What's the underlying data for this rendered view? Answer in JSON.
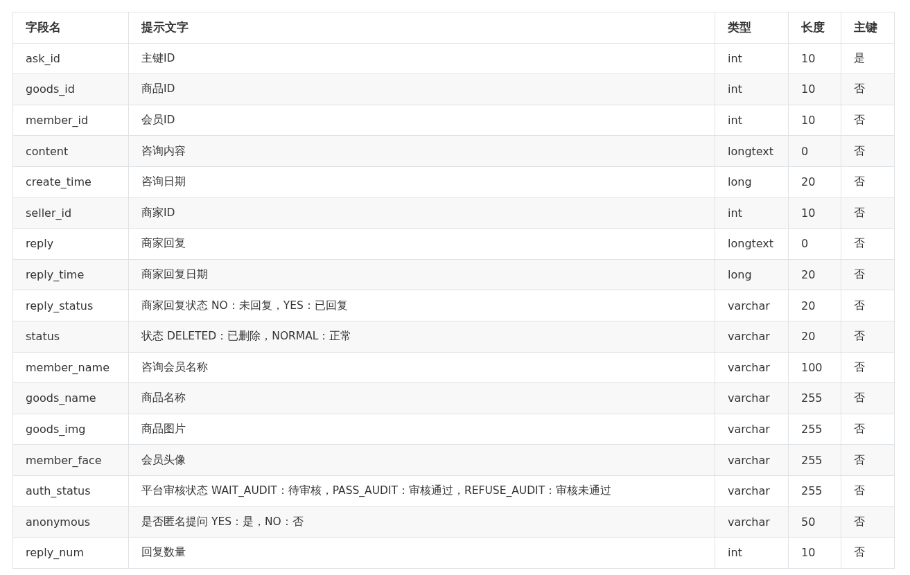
{
  "table": {
    "columns": [
      "字段名",
      "提示文字",
      "类型",
      "长度",
      "主键"
    ],
    "rows": [
      [
        "ask_id",
        "主键ID",
        "int",
        "10",
        "是"
      ],
      [
        "goods_id",
        "商品ID",
        "int",
        "10",
        "否"
      ],
      [
        "member_id",
        "会员ID",
        "int",
        "10",
        "否"
      ],
      [
        "content",
        "咨询内容",
        "longtext",
        "0",
        "否"
      ],
      [
        "create_time",
        "咨询日期",
        "long",
        "20",
        "否"
      ],
      [
        "seller_id",
        "商家ID",
        "int",
        "10",
        "否"
      ],
      [
        "reply",
        "商家回复",
        "longtext",
        "0",
        "否"
      ],
      [
        "reply_time",
        "商家回复日期",
        "long",
        "20",
        "否"
      ],
      [
        "reply_status",
        "商家回复状态 NO：未回复，YES：已回复",
        "varchar",
        "20",
        "否"
      ],
      [
        "status",
        "状态 DELETED：已删除，NORMAL：正常",
        "varchar",
        "20",
        "否"
      ],
      [
        "member_name",
        "咨询会员名称",
        "varchar",
        "100",
        "否"
      ],
      [
        "goods_name",
        "商品名称",
        "varchar",
        "255",
        "否"
      ],
      [
        "goods_img",
        "商品图片",
        "varchar",
        "255",
        "否"
      ],
      [
        "member_face",
        "会员头像",
        "varchar",
        "255",
        "否"
      ],
      [
        "auth_status",
        "平台审核状态 WAIT_AUDIT：待审核，PASS_AUDIT：审核通过，REFUSE_AUDIT：审核未通过",
        "varchar",
        "255",
        "否"
      ],
      [
        "anonymous",
        "是否匿名提问 YES：是，NO：否",
        "varchar",
        "50",
        "否"
      ],
      [
        "reply_num",
        "回复数量",
        "int",
        "10",
        "否"
      ]
    ]
  }
}
